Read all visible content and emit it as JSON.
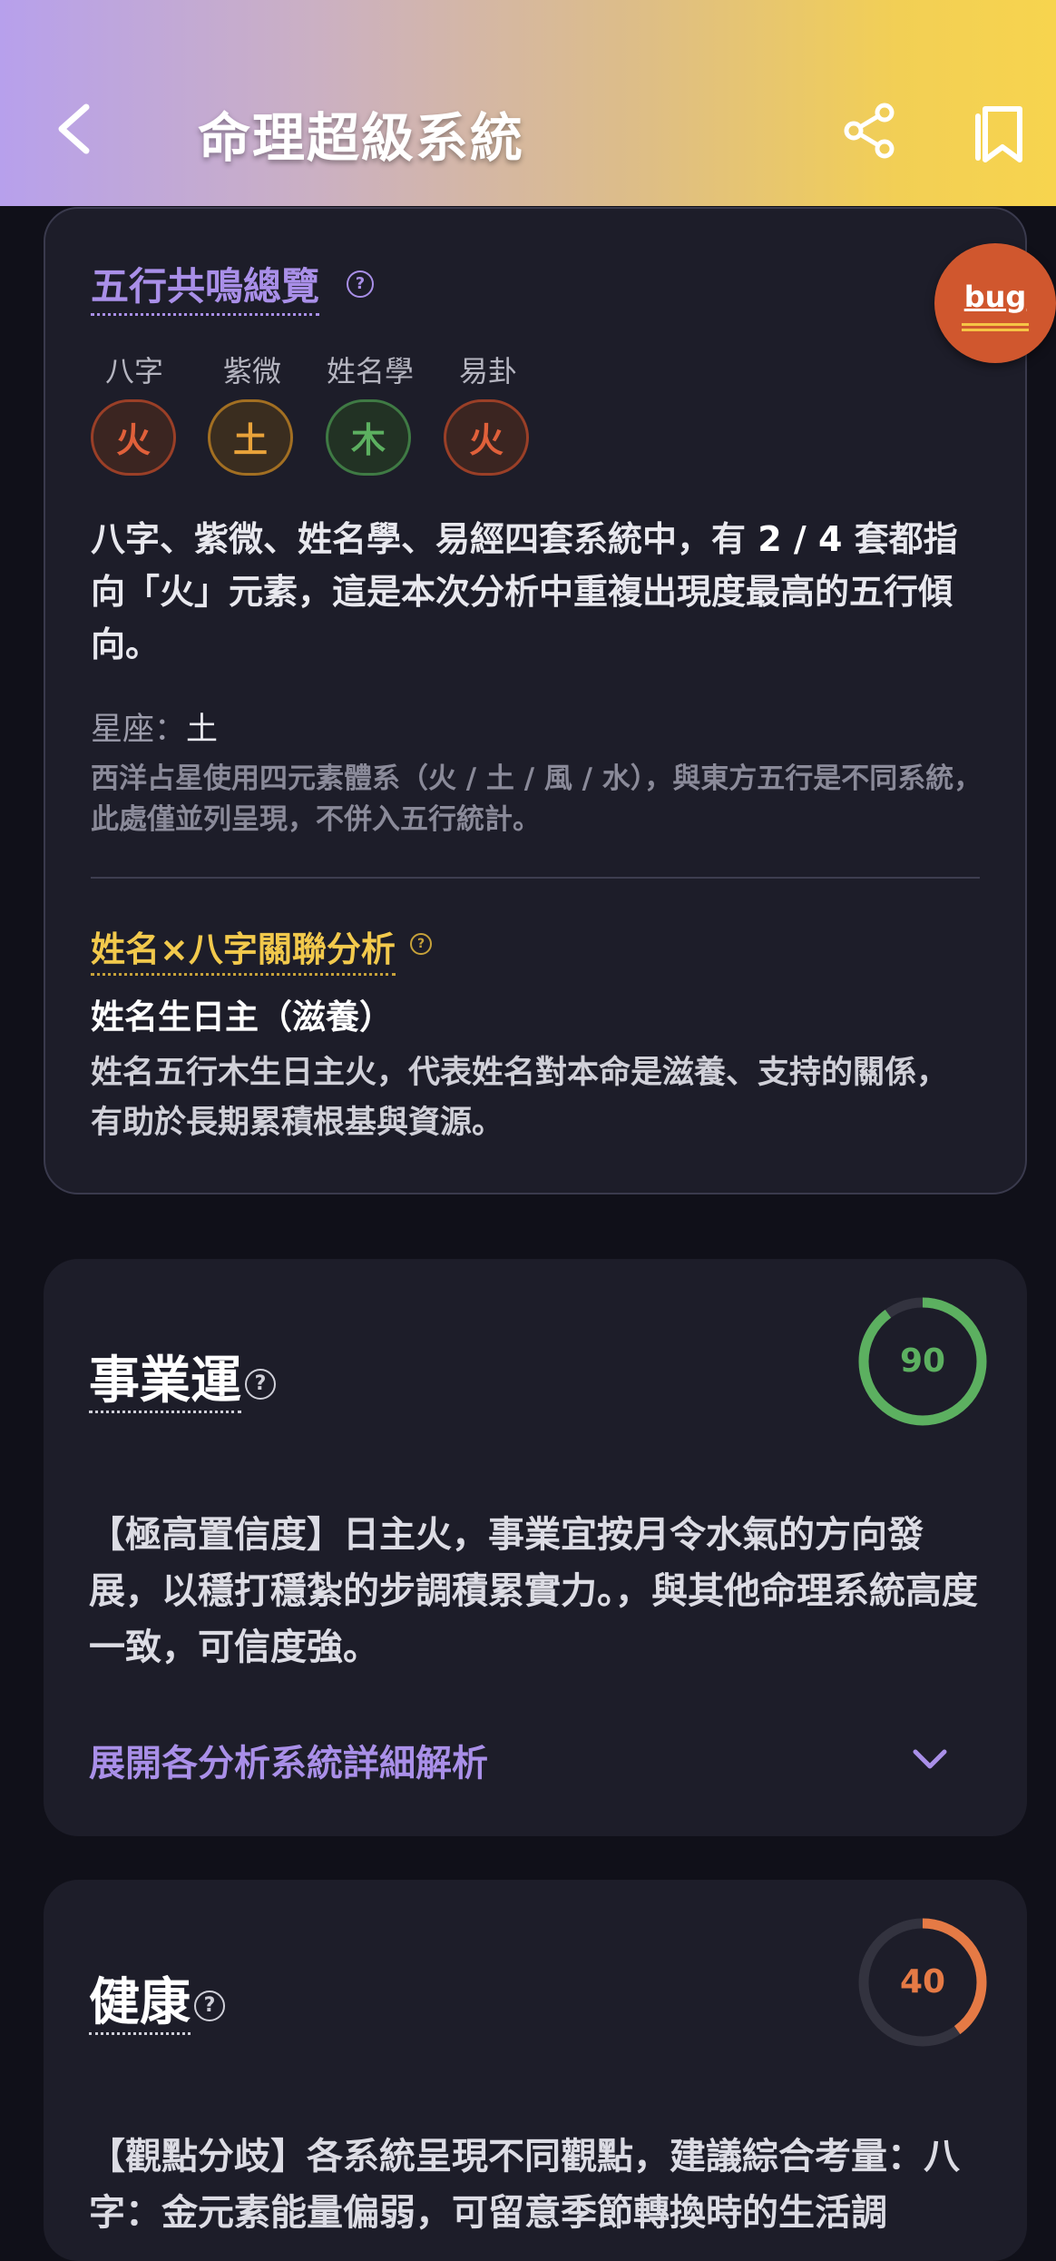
{
  "header": {
    "title": "命理超級系統",
    "gradient": [
      "#b7a0ec",
      "#f7d44e"
    ]
  },
  "resonance": {
    "title": "五行共鳴總覽",
    "systems": [
      {
        "label": "八字",
        "element": "火",
        "color": "#e0603a"
      },
      {
        "label": "紫微",
        "element": "土",
        "color": "#e9a33a"
      },
      {
        "label": "姓名學",
        "element": "木",
        "color": "#5cb060"
      },
      {
        "label": "易卦",
        "element": "火",
        "color": "#e0603a"
      }
    ],
    "summary_pre": "八字、紫微、姓名學、易經四套系統中，有 ",
    "summary_count": "2 / 4",
    "summary_post": " 套都指向「火」元素，這是本次分析中重複出現度最高的五行傾向。",
    "star_label": "星座：",
    "star_value": "土",
    "star_note": "西洋占星使用四元素體系（火 / 土 / 風 / 水），與東方五行是不同系統，此處僅並列呈現，不併入五行統計。"
  },
  "relation": {
    "title": "姓名×八字關聯分析",
    "subtitle": "姓名生日主（滋養）",
    "body": "姓名五行木生日主火，代表姓名對本命是滋養、支持的關係，有助於長期累積根基與資源。"
  },
  "bug_button": {
    "label": "bug"
  },
  "career": {
    "title": "事業運",
    "score": 90,
    "score_text": "90",
    "score_color": "#5cb060",
    "body": "【極高置信度】日主火，事業宜按月令水氣的方向發展，以穩打穩紮的步調積累實力。，與其他命理系統高度一致，可信度強。",
    "expand_label": "展開各分析系統詳細解析"
  },
  "health": {
    "title": "健康",
    "score": 40,
    "score_text": "40",
    "score_color": "#e57a45",
    "body": "【觀點分歧】各系統呈現不同觀點，建議綜合考量：八字：金元素能量偏弱，可留意季節轉換時的生活調"
  }
}
